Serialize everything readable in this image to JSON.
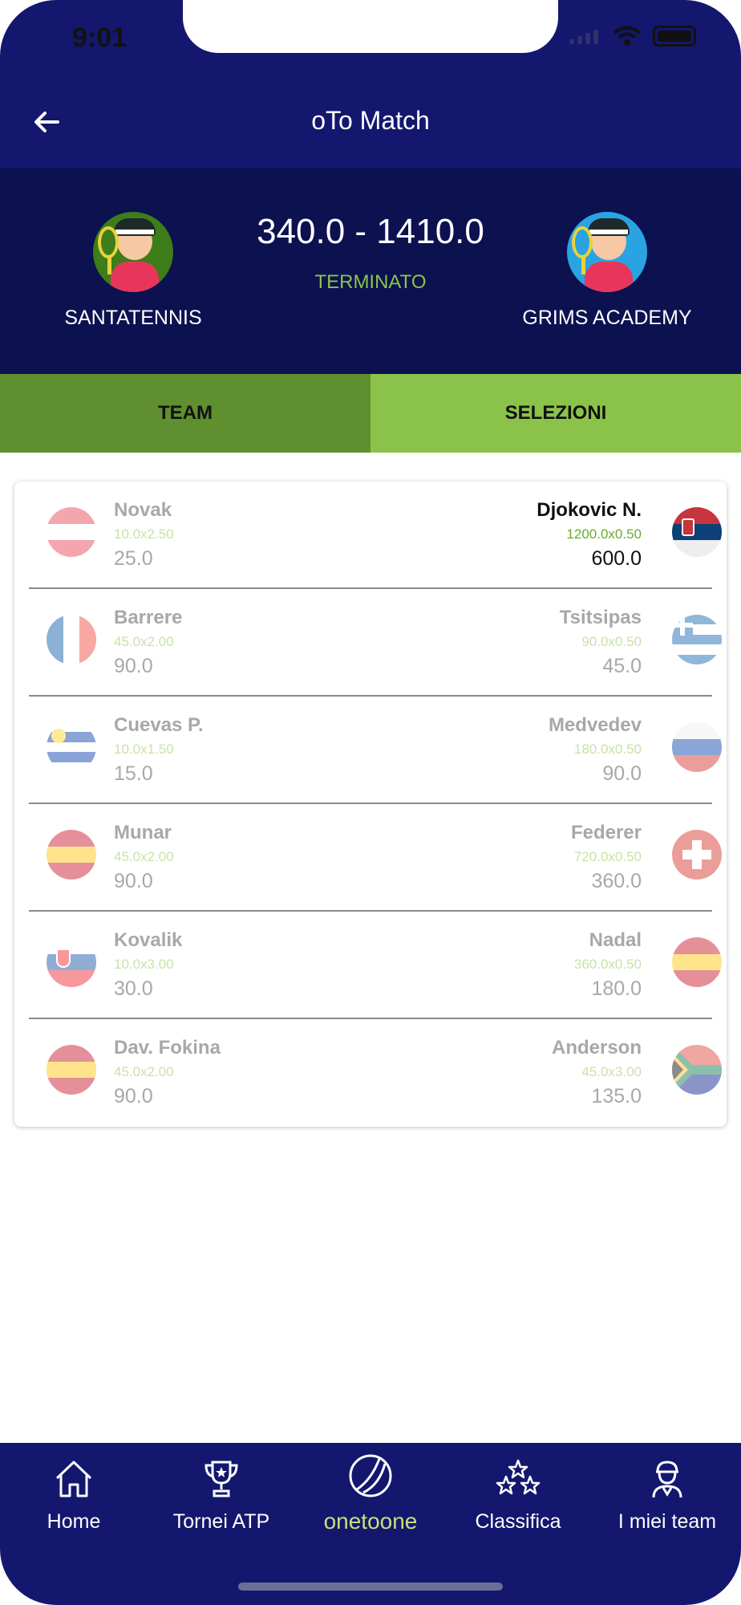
{
  "status_bar": {
    "time": "9:01"
  },
  "header": {
    "title": "oTo Match"
  },
  "match": {
    "home_team": "SANTATENNIS",
    "away_team": "GRIMS ACADEMY",
    "score": "340.0 - 1410.0",
    "status": "TERMINATO"
  },
  "tabs": [
    {
      "label": "TEAM"
    },
    {
      "label": "SELEZIONI"
    }
  ],
  "rows": [
    {
      "left": {
        "name": "Novak",
        "calc": "10.0x2.50",
        "points": "25.0",
        "flag": "austria"
      },
      "right": {
        "name": "Djokovic N.",
        "calc": "1200.0x0.50",
        "points": "600.0",
        "flag": "serbia"
      }
    },
    {
      "left": {
        "name": "Barrere",
        "calc": "45.0x2.00",
        "points": "90.0",
        "flag": "france"
      },
      "right": {
        "name": "Tsitsipas",
        "calc": "90.0x0.50",
        "points": "45.0",
        "flag": "greece"
      }
    },
    {
      "left": {
        "name": "Cuevas P.",
        "calc": "10.0x1.50",
        "points": "15.0",
        "flag": "uruguay"
      },
      "right": {
        "name": "Medvedev",
        "calc": "180.0x0.50",
        "points": "90.0",
        "flag": "russia"
      }
    },
    {
      "left": {
        "name": "Munar",
        "calc": "45.0x2.00",
        "points": "90.0",
        "flag": "spain"
      },
      "right": {
        "name": "Federer",
        "calc": "720.0x0.50",
        "points": "360.0",
        "flag": "switzerland"
      }
    },
    {
      "left": {
        "name": "Kovalik",
        "calc": "10.0x3.00",
        "points": "30.0",
        "flag": "slovakia"
      },
      "right": {
        "name": "Nadal",
        "calc": "360.0x0.50",
        "points": "180.0",
        "flag": "spain"
      }
    },
    {
      "left": {
        "name": "Dav. Fokina",
        "calc": "45.0x2.00",
        "points": "90.0",
        "flag": "spain"
      },
      "right": {
        "name": "Anderson",
        "calc": "45.0x3.00",
        "points": "135.0",
        "flag": "south-africa"
      }
    }
  ],
  "nav": [
    {
      "label": "Home",
      "icon": "home-icon"
    },
    {
      "label": "Tornei ATP",
      "icon": "trophy-icon"
    },
    {
      "label": "onetoone",
      "icon": "tennis-ball-icon"
    },
    {
      "label": "Classifica",
      "icon": "stars-icon"
    },
    {
      "label": "I miei team",
      "icon": "player-icon"
    }
  ],
  "colors": {
    "navy": "#14176e",
    "dark_navy": "#0c1150",
    "accent_green": "#8bc34a",
    "tab_dark_green": "#5f8f2e"
  }
}
